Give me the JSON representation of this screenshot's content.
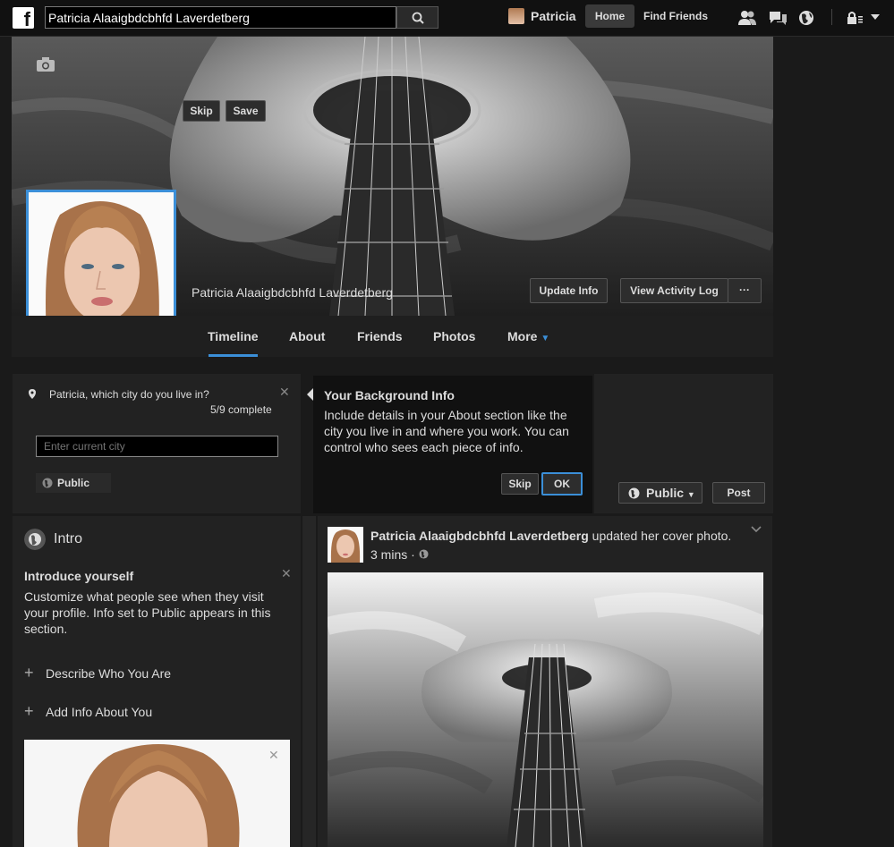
{
  "search": {
    "value": "Patricia Alaaigbdcbhfd Laverdetberg"
  },
  "nav": {
    "user_name": "Patricia",
    "home_label": "Home",
    "find_friends_label": "Find Friends"
  },
  "profile": {
    "full_name": "Patricia Alaaigbdcbhfd Laverdetberg",
    "update_info_label": "Update Info",
    "activity_log_label": "View Activity Log",
    "more_label": "···"
  },
  "tabs": [
    {
      "label": "Timeline"
    },
    {
      "label": "About"
    },
    {
      "label": "Friends"
    },
    {
      "label": "Photos"
    },
    {
      "label": "More"
    }
  ],
  "city_prompt": {
    "question": "Patricia, which city do you live in?",
    "progress": "5/9 complete",
    "input_placeholder": "Enter current city",
    "privacy_label": "Public",
    "skip_label": "Skip",
    "save_label": "Save"
  },
  "tooltip": {
    "title": "Your Background Info",
    "body": "Include details in your About section like the city you live in and where you work. You can control who sees each piece of info.",
    "skip_label": "Skip",
    "ok_label": "OK"
  },
  "composer": {
    "privacy_label": "Public",
    "post_label": "Post"
  },
  "intro": {
    "title": "Intro",
    "introduce_title": "Introduce yourself",
    "introduce_body": "Customize what people see when they visit your profile. Info set to Public appears in this section.",
    "describe_label": "Describe Who You Are",
    "add_info_label": "Add Info About You"
  },
  "post": {
    "author": "Patricia Alaaigbdcbhfd Laverdetberg",
    "action": "updated her cover photo.",
    "time": "3 mins ·"
  },
  "colors": {
    "accent": "#3b8fd8",
    "background": "#1a1a1a",
    "panel": "#222222"
  },
  "icons": [
    "facebook-logo-icon",
    "search-icon",
    "friends-icon",
    "messages-icon",
    "globe-icon",
    "lock-icon",
    "caret-down-icon",
    "camera-icon",
    "location-pin-icon",
    "close-icon",
    "plus-icon",
    "chevron-down-icon"
  ]
}
